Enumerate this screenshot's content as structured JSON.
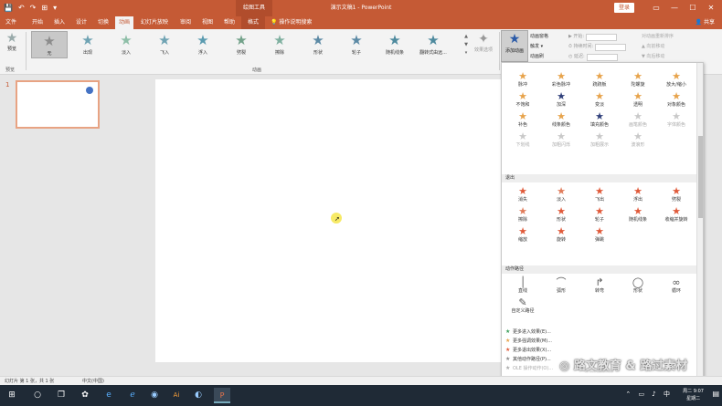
{
  "titlebar": {
    "quick_access": [
      "💾",
      "↶",
      "↷",
      "⊞",
      "▾"
    ],
    "context_tab": "绘图工具",
    "title": "演示文稿1 - PowerPoint",
    "login": "登录",
    "window_buttons": [
      "▭",
      "—",
      "☐",
      "✕"
    ]
  },
  "tabs": {
    "items": [
      "文件",
      "开始",
      "插入",
      "设计",
      "切换",
      "动画",
      "幻灯片放映",
      "审阅",
      "视图",
      "帮助",
      "格式",
      "操作说明搜索"
    ],
    "active": "动画",
    "share": "共享"
  },
  "ribbon": {
    "preview_label": "预览",
    "preview_group": "预览",
    "animation_group": "动画",
    "effects": [
      {
        "label": "无",
        "color": "#8c8c8c"
      },
      {
        "label": "出现",
        "color": "#6fa3b3"
      },
      {
        "label": "淡入",
        "color": "#8fbfa8"
      },
      {
        "label": "飞入",
        "color": "#6fa3b3"
      },
      {
        "label": "浮入",
        "color": "#5b9bb0"
      },
      {
        "label": "劈裂",
        "color": "#73a28a"
      },
      {
        "label": "擦除",
        "color": "#7fb0a0"
      },
      {
        "label": "形状",
        "color": "#5c8aa5"
      },
      {
        "label": "轮子",
        "color": "#5c8aa5"
      },
      {
        "label": "随机线条",
        "color": "#4e8a9e"
      },
      {
        "label": "翻转式由远...",
        "color": "#4e8a9e"
      }
    ],
    "effect_options": "效果选项",
    "add_animation": "添加动画",
    "advanced": [
      "动画窗格",
      "触发 ▾",
      "动画刷"
    ],
    "timing": [
      {
        "label": "▶ 开始:"
      },
      {
        "label": "⏱ 持续时间:"
      },
      {
        "label": "◴ 延迟:"
      }
    ],
    "reorder": [
      "对动画重新排序",
      "▲ 向前移动",
      "▼ 向后移动"
    ]
  },
  "slides_pane": {
    "slide_number": "1"
  },
  "gallery": {
    "emphasis_items": [
      {
        "label": "脉冲",
        "color": "#e7a34b",
        "dim": false
      },
      {
        "label": "彩色脉冲",
        "color": "#e7a34b",
        "dim": false
      },
      {
        "label": "跷跷板",
        "color": "#e7a34b",
        "dim": false
      },
      {
        "label": "陀螺旋",
        "color": "#e7a34b",
        "dim": false
      },
      {
        "label": "放大/缩小",
        "color": "#e7a34b",
        "dim": false
      },
      {
        "label": "不饱和",
        "color": "#e7a34b",
        "dim": false
      },
      {
        "label": "加深",
        "color": "#2f3f7a",
        "dim": false
      },
      {
        "label": "变淡",
        "color": "#e7a34b",
        "dim": false
      },
      {
        "label": "透明",
        "color": "#e7a34b",
        "dim": false
      },
      {
        "label": "对象颜色",
        "color": "#e7a34b",
        "dim": false
      },
      {
        "label": "补色",
        "color": "#e7a34b",
        "dim": false
      },
      {
        "label": "线条颜色",
        "color": "#e7a34b",
        "dim": false
      },
      {
        "label": "填充颜色",
        "color": "#2f3f7a",
        "dim": false
      },
      {
        "label": "画笔颜色",
        "color": "#c9c9c9",
        "dim": true
      },
      {
        "label": "字体颜色",
        "color": "#c9c9c9",
        "dim": true
      },
      {
        "label": "下划线",
        "color": "#c9c9c9",
        "dim": true
      },
      {
        "label": "加粗闪烁",
        "color": "#c9c9c9",
        "dim": true
      },
      {
        "label": "加粗展示",
        "color": "#c9c9c9",
        "dim": true
      },
      {
        "label": "波浪形",
        "color": "#c9c9c9",
        "dim": true
      }
    ],
    "exit_header": "退出",
    "exit_items": [
      {
        "label": "消失",
        "color": "#e05a3a"
      },
      {
        "label": "淡入",
        "color": "#e07b5a"
      },
      {
        "label": "飞出",
        "color": "#e05a3a"
      },
      {
        "label": "浮出",
        "color": "#e05a3a"
      },
      {
        "label": "劈裂",
        "color": "#e05a3a"
      },
      {
        "label": "擦除",
        "color": "#e07b5a"
      },
      {
        "label": "形状",
        "color": "#e05a3a"
      },
      {
        "label": "轮子",
        "color": "#e05a3a"
      },
      {
        "label": "随机线条",
        "color": "#e05a3a"
      },
      {
        "label": "收缩并旋转",
        "color": "#e05a3a"
      },
      {
        "label": "缩放",
        "color": "#e05a3a"
      },
      {
        "label": "旋转",
        "color": "#e05a3a"
      },
      {
        "label": "弹跳",
        "color": "#e05a3a"
      }
    ],
    "path_header": "动作路径",
    "path_items": [
      {
        "label": "直线"
      },
      {
        "label": "弧形"
      },
      {
        "label": "转弯"
      },
      {
        "label": "形状"
      },
      {
        "label": "循环"
      },
      {
        "label": "自定义路径"
      }
    ],
    "links": [
      {
        "label": "更多进入效果(E)...",
        "color": "#3a9e5a",
        "dim": false
      },
      {
        "label": "更多强调效果(M)...",
        "color": "#e7a34b",
        "dim": false
      },
      {
        "label": "更多退出效果(X)...",
        "color": "#e05a3a",
        "dim": false
      },
      {
        "label": "其他动作路径(P)...",
        "color": "#888888",
        "dim": false
      },
      {
        "label": "OLE 操作动作(O)...",
        "color": "#aaaaaa",
        "dim": true
      }
    ]
  },
  "statusbar": {
    "slide_info": "幻灯片 第 1 张，共 1 张",
    "language": "中文(中国)"
  },
  "taskbar": {
    "clock_time": "周二 9:07",
    "clock_day": "星期二"
  },
  "watermark": {
    "text": "◎ 路文教育 & 路过素材",
    "subtext": "LU WEN EDUCATION"
  }
}
